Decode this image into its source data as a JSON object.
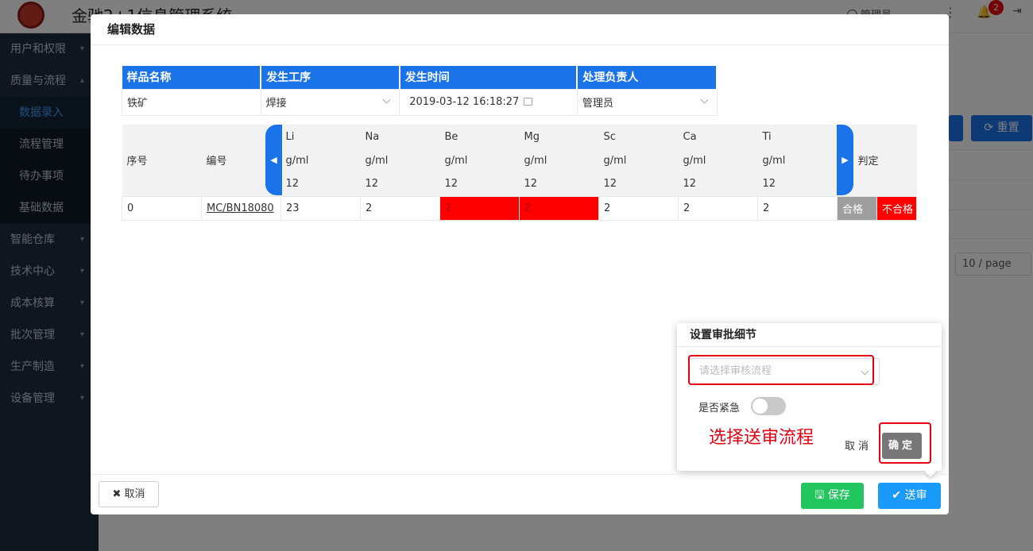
{
  "app": {
    "title": "金驰2+1信息管理系统",
    "user": "管理员",
    "notification_count": "2"
  },
  "sidebar": {
    "items": [
      {
        "label": "用户和权限",
        "chevron": "⌄"
      },
      {
        "label": "质量与流程",
        "chevron": "⌃"
      },
      {
        "label": "数据录入"
      },
      {
        "label": "流程管理"
      },
      {
        "label": "待办事项"
      },
      {
        "label": "基础数据"
      },
      {
        "label": "智能仓库",
        "chevron": "⌄"
      },
      {
        "label": "技术中心",
        "chevron": "⌄"
      },
      {
        "label": "成本核算",
        "chevron": "⌄"
      },
      {
        "label": "批次管理",
        "chevron": "⌄"
      },
      {
        "label": "生产制造",
        "chevron": "⌄"
      },
      {
        "label": "设备管理",
        "chevron": "⌄"
      }
    ]
  },
  "background": {
    "reset_label": "重置",
    "page_size": "10 / page"
  },
  "modal": {
    "title": "编辑数据",
    "info_headers": [
      "样品名称",
      "发生工序",
      "发生时间",
      "处理负责人"
    ],
    "info_values": [
      "铁矿",
      "焊接",
      "2019-03-12 16:18:27",
      "管理员"
    ],
    "data_headers": {
      "seq": "序号",
      "code": "编号",
      "verdict": "判定",
      "elements": [
        {
          "name": "Li",
          "unit": "g/ml",
          "std": "12"
        },
        {
          "name": "Na",
          "unit": "g/ml",
          "std": "12"
        },
        {
          "name": "Be",
          "unit": "g/ml",
          "std": "12"
        },
        {
          "name": "Mg",
          "unit": "g/ml",
          "std": "12"
        },
        {
          "name": "Sc",
          "unit": "g/ml",
          "std": "12"
        },
        {
          "name": "Ca",
          "unit": "g/ml",
          "std": "12"
        },
        {
          "name": "Ti",
          "unit": "g/ml",
          "std": "12"
        }
      ]
    },
    "row": {
      "seq": "0",
      "code": "MC/BN18080",
      "values": [
        "23",
        "2",
        "2",
        "2",
        "2",
        "2",
        "2"
      ],
      "pass_label": "合格",
      "fail_label": "不合格"
    },
    "footer": {
      "cancel_label": "取消",
      "save_label": "保存",
      "submit_label": "送审"
    }
  },
  "popover": {
    "title": "设置审批细节",
    "select_placeholder": "请选择审核流程",
    "urgent_label": "是否紧急",
    "urgent_value": false,
    "annotation": "选择送审流程",
    "cancel_label": "取消",
    "ok_label": "确定"
  },
  "colors": {
    "primary": "#1a73e8",
    "danger": "#ff0000",
    "success": "#22c55e",
    "sidebar_bg": "#1f2d3d"
  }
}
